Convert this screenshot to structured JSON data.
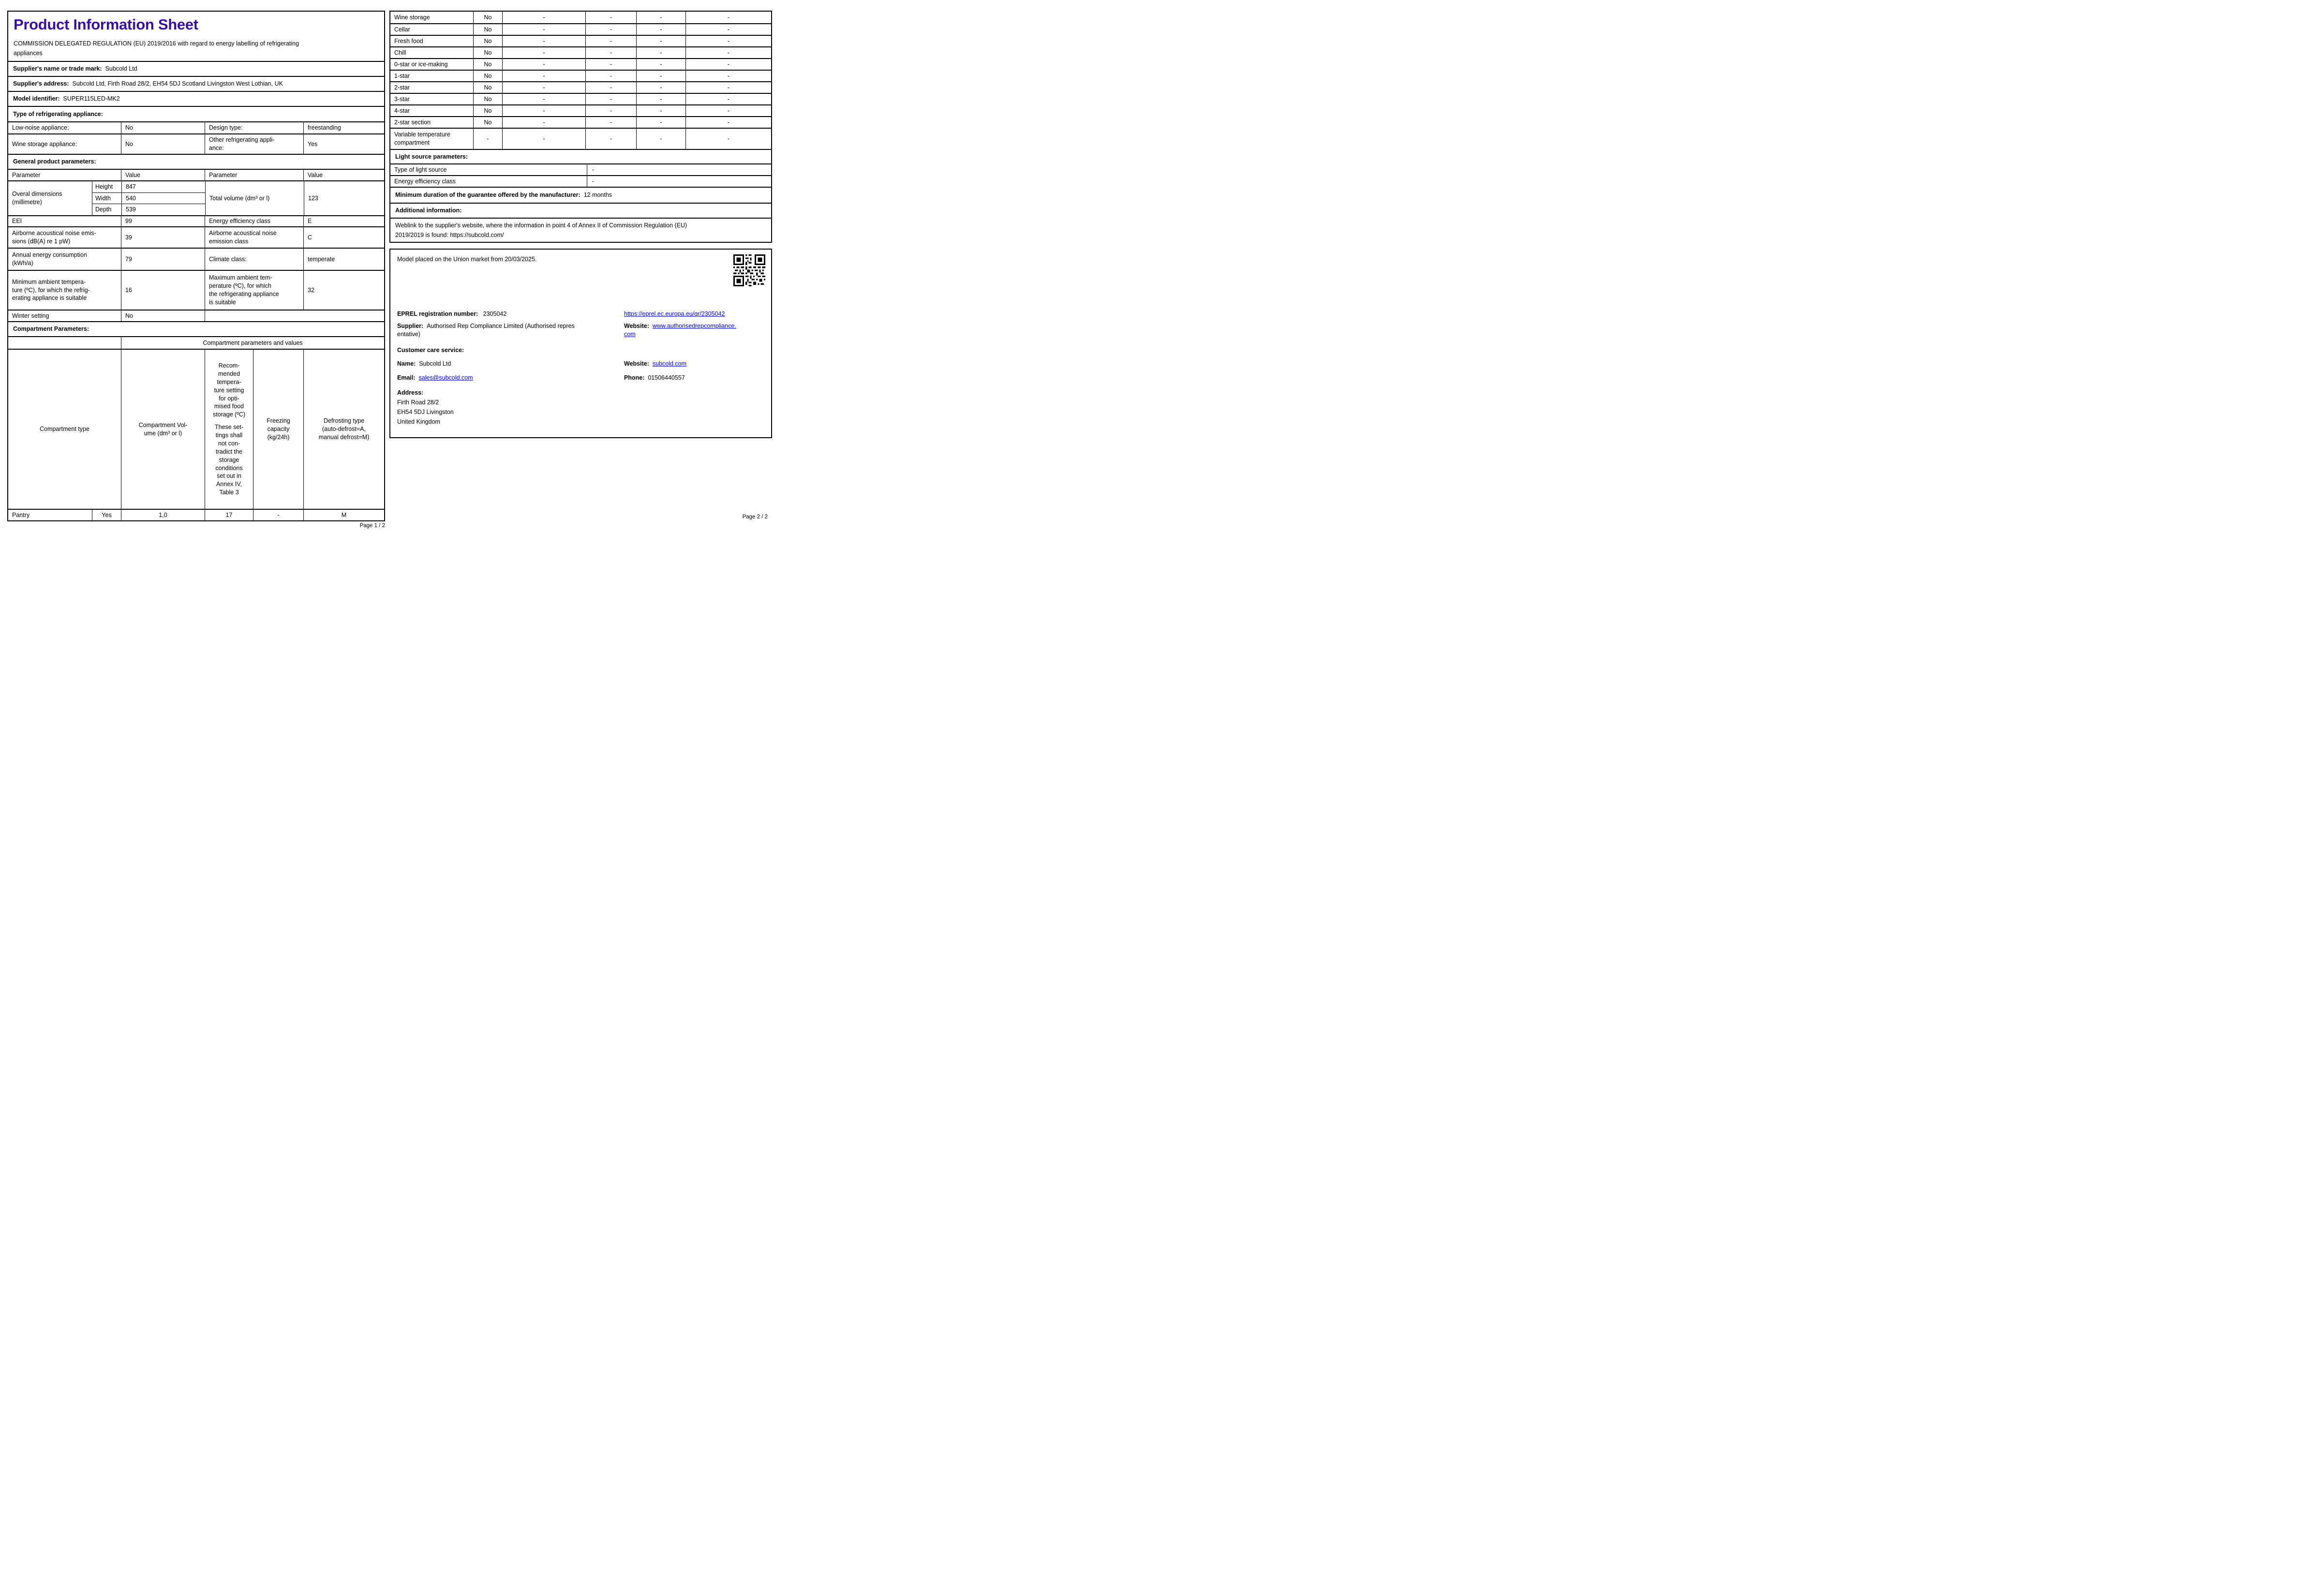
{
  "accent_color": "#3b0f9d",
  "link_color": "#0000ee",
  "page1": {
    "title": "Product Information Sheet",
    "regulation_text": "COMMISSION DELEGATED REGULATION (EU) 2019/2016 with regard to energy labelling of refrigerating\nappliances",
    "supplier_name": {
      "label": "Supplier's name or trade mark:",
      "value": "Subcold Ltd"
    },
    "supplier_address": {
      "label": "Supplier's address:",
      "value": "Subcold Ltd, Firth Road 28/2, EH54 5DJ Scotland Livingston West Lothian, UK"
    },
    "model_identifier": {
      "label": "Model identifier:",
      "value": "SUPER115LED-MK2"
    },
    "type_section_label": "Type of refrigerating appliance:",
    "type_rows": {
      "low_noise_label": "Low-noise appliance:",
      "low_noise_value": "No",
      "design_type_label": "Design type:",
      "design_type_value": "freestanding",
      "wine_storage_label": "Wine storage appliance:",
      "wine_storage_value": "No",
      "other_label": "Other refrigerating appli-\nance:",
      "other_value": "Yes"
    },
    "general_section_label": "General product parameters:",
    "param_header": {
      "p1": "Parameter",
      "v1": "Value",
      "p2": "Parameter",
      "v2": "Value"
    },
    "dimensions": {
      "label": "Overal dimensions\n(millimetre)",
      "height_label": "Height",
      "height": "847",
      "width_label": "Width",
      "width": "540",
      "depth_label": "Depth",
      "depth": "539",
      "volume_label": "Total volume (dm³ or l)",
      "volume": "123"
    },
    "eei": {
      "label": "EEI",
      "value": "99",
      "class_label": "Energy efficiency class",
      "class_value": "E"
    },
    "noise": {
      "label": "Airborne acoustical noise emis-\nsions (dB(A) re 1 pW)",
      "value": "39",
      "class_label": "Airborne acoustical noise\nemission class",
      "class_value": "C"
    },
    "energy": {
      "label": "Annual energy consumption\n(kWh/a)",
      "value": "79",
      "climate_label": "Climate class:",
      "climate_value": "temperate"
    },
    "ambient": {
      "min_label": "Minimum ambient tempera-\nture (ºC), for which the refrig-\nerating appliance is suitable",
      "min_value": "16",
      "max_label": "Maximum ambient tem-\nperature (ºC), for which\nthe refrigerating appliance\nis suitable",
      "max_value": "32"
    },
    "winter": {
      "label": "Winter setting",
      "value": "No"
    },
    "compartment_section_label": "Compartment Parameters:",
    "compartment_table": {
      "span_header": "Compartment parameters and values",
      "col_type": "Compartment type",
      "col_volume": "Compartment Vol-\nume (dm³ or l)",
      "col_temp_1": "Recom-\nmended\ntempera-\nture setting\nfor opti-\nmised food\nstorage (ºC)",
      "col_temp_2": "These set-\ntings shall\nnot con-\ntradict the\nstorage\nconditions\nset out in\nAnnex IV,\nTable 3",
      "col_freezing": "Freezing\ncapacity\n(kg/24h)",
      "col_defrost": "Defrosting type\n(auto-defrost=A,\nmanual defrost=M)",
      "row": {
        "type": "Pantry",
        "present": "Yes",
        "volume": "1,0",
        "temp": "17",
        "freezing": "-",
        "defrost": "M"
      }
    },
    "footer": "Page 1 / 2"
  },
  "page2": {
    "star_table": {
      "rows": [
        {
          "label": "Wine storage",
          "value": "No",
          "dashes": [
            "-",
            "-",
            "-",
            "-"
          ]
        },
        {
          "label": "Cellar",
          "value": "No",
          "dashes": [
            "-",
            "-",
            "-",
            "-"
          ]
        },
        {
          "label": "Fresh food",
          "value": "No",
          "dashes": [
            "-",
            "-",
            "-",
            "-"
          ]
        },
        {
          "label": "Chill",
          "value": "No",
          "dashes": [
            "-",
            "-",
            "-",
            "-"
          ]
        },
        {
          "label": "0-star or ice-making",
          "value": "No",
          "dashes": [
            "-",
            "-",
            "-",
            "-"
          ]
        },
        {
          "label": "1-star",
          "value": "No",
          "dashes": [
            "-",
            "-",
            "-",
            "-"
          ]
        },
        {
          "label": "2-star",
          "value": "No",
          "dashes": [
            "-",
            "-",
            "-",
            "-"
          ]
        },
        {
          "label": "3-star",
          "value": "No",
          "dashes": [
            "-",
            "-",
            "-",
            "-"
          ]
        },
        {
          "label": "4-star",
          "value": "No",
          "dashes": [
            "-",
            "-",
            "-",
            "-"
          ]
        },
        {
          "label": "2-star section",
          "value": "No",
          "dashes": [
            "-",
            "-",
            "-",
            "-"
          ]
        },
        {
          "label": "Variable temperature\ncompartment",
          "value": "-",
          "dashes": [
            "-",
            "-",
            "-",
            "-"
          ]
        }
      ]
    },
    "light_section_label": "Light source parameters:",
    "light_rows": [
      {
        "label": "Type of light source",
        "value": "-"
      },
      {
        "label": "Energy efficiency class",
        "value": "-"
      }
    ],
    "guarantee": {
      "label": "Minimum duration of the guarantee offered by the manufacturer:",
      "value": "12 months"
    },
    "additional_section_label": "Additional information:",
    "weblink": {
      "text": "Weblink to the supplier's website, where the information in point 4 of Annex II of Commission Regulation (EU)\n2019/2019 is found:",
      "url": "https://subcold.com/"
    },
    "market_info": {
      "model_placed": "Model placed on the Union market from 20/03/2025.",
      "eprel": {
        "label": "EPREL registration number:",
        "value": "2305042",
        "link": "https://eprel.ec.europa.eu/qr/2305042"
      },
      "supplier": {
        "label": "Supplier:",
        "value": "Authorised Rep Compliance Limited (Authorised repres\nentative)"
      },
      "supplier_website": {
        "label": "Website:",
        "value": "www.authorisedrepcompliance.\ncom"
      },
      "customer_care_label": "Customer care service:",
      "care_name": {
        "label": "Name:",
        "value": "Subcold Ltd"
      },
      "care_website": {
        "label": "Website:",
        "value": "subcold.com"
      },
      "care_email": {
        "label": "Email:",
        "value": "sales@subcold.com"
      },
      "care_phone": {
        "label": "Phone:",
        "value": "01506440557"
      },
      "address_label": "Address:",
      "address_lines": [
        "Firth Road 28/2",
        "EH54 5DJ Livingston",
        "United Kingdom"
      ]
    },
    "footer": "Page 2 / 2"
  }
}
